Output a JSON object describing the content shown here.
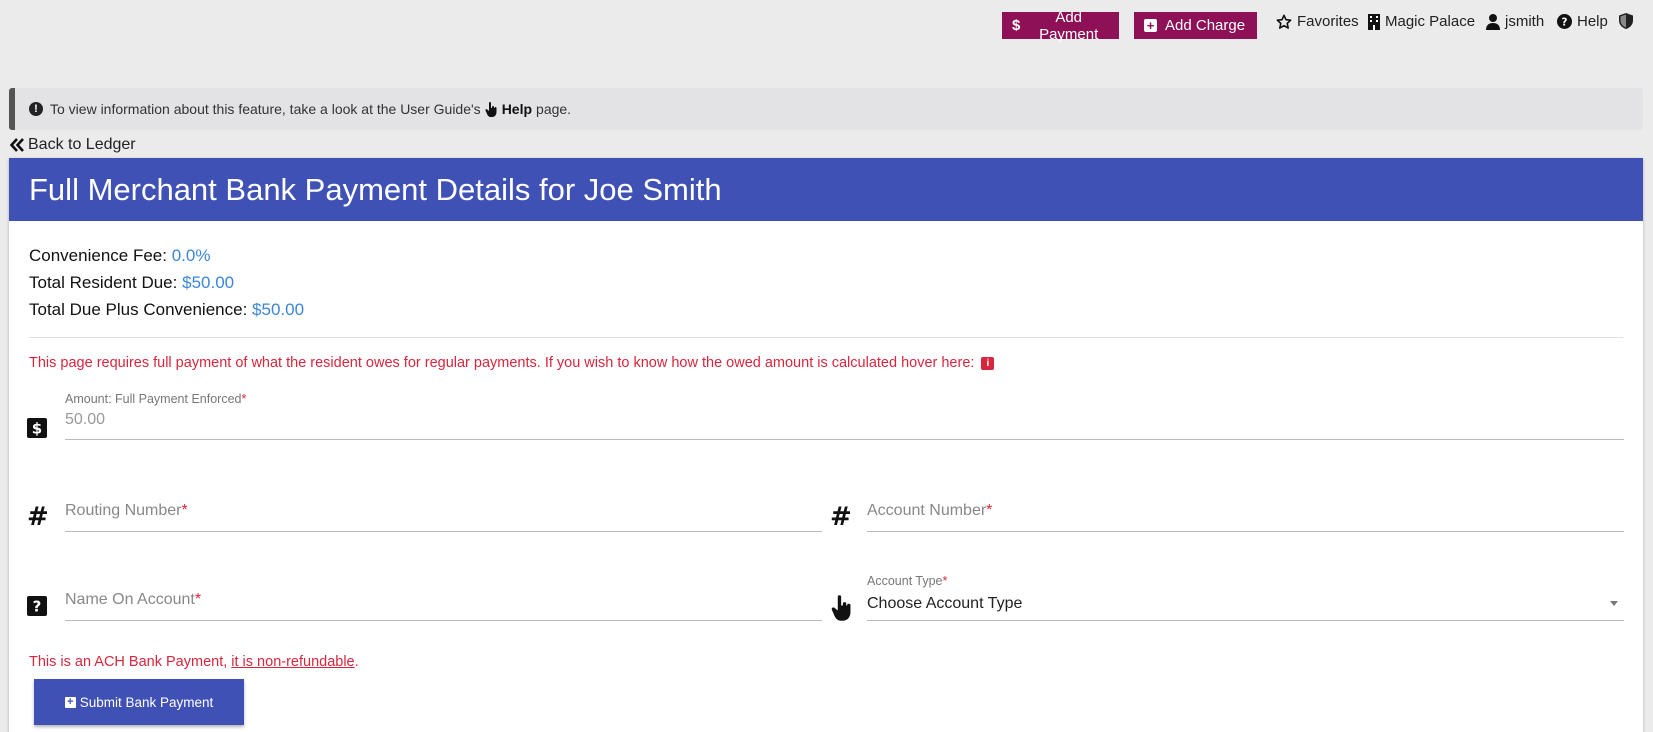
{
  "topnav": {
    "add_payment": "Add Payment",
    "add_charge": "Add Charge",
    "favorites": "Favorites",
    "property": "Magic Palace",
    "user": "jsmith",
    "help": "Help"
  },
  "banner": {
    "text_before": "To view information about this feature, take a look at the User Guide's",
    "help_word": "Help",
    "text_after": "page."
  },
  "back_link": "Back to Ledger",
  "card": {
    "title": "Full Merchant Bank Payment Details for Joe Smith"
  },
  "summary": {
    "fee_label": "Convenience Fee:",
    "fee_value": "0.0%",
    "due_label": "Total Resident Due:",
    "due_value": "$50.00",
    "total_label": "Total Due Plus Convenience:",
    "total_value": "$50.00"
  },
  "warning": "This page requires full payment of what the resident owes for regular payments. If you wish to know how the owed amount is calculated hover here:",
  "form": {
    "amount_label": "Amount: Full Payment Enforced",
    "amount_value": "50.00",
    "routing_placeholder": "Routing Number",
    "account_placeholder": "Account Number",
    "name_placeholder": "Name On Account",
    "account_type_label": "Account Type",
    "account_type_value": "Choose Account Type",
    "required_mark": "*"
  },
  "ach": {
    "text_before": "This is an ACH Bank Payment,",
    "link": "it is non-refundable",
    "text_after": "."
  },
  "submit_label": "Submit Bank Payment",
  "colors": {
    "accent": "#3f51b5",
    "top_button": "#8e1158",
    "error": "#d7263d",
    "value_blue": "#3a86d8"
  }
}
